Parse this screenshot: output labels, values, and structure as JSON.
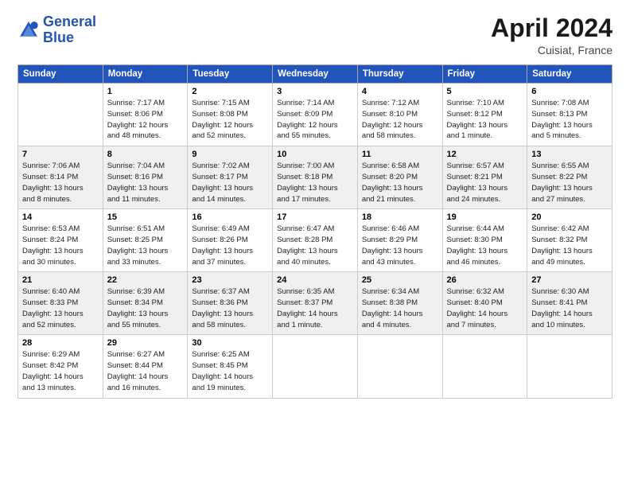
{
  "header": {
    "logo_line1": "General",
    "logo_line2": "Blue",
    "title": "April 2024",
    "location": "Cuisiat, France"
  },
  "days_of_week": [
    "Sunday",
    "Monday",
    "Tuesday",
    "Wednesday",
    "Thursday",
    "Friday",
    "Saturday"
  ],
  "weeks": [
    [
      {
        "day": "",
        "content": ""
      },
      {
        "day": "1",
        "content": "Sunrise: 7:17 AM\nSunset: 8:06 PM\nDaylight: 12 hours\nand 48 minutes."
      },
      {
        "day": "2",
        "content": "Sunrise: 7:15 AM\nSunset: 8:08 PM\nDaylight: 12 hours\nand 52 minutes."
      },
      {
        "day": "3",
        "content": "Sunrise: 7:14 AM\nSunset: 8:09 PM\nDaylight: 12 hours\nand 55 minutes."
      },
      {
        "day": "4",
        "content": "Sunrise: 7:12 AM\nSunset: 8:10 PM\nDaylight: 12 hours\nand 58 minutes."
      },
      {
        "day": "5",
        "content": "Sunrise: 7:10 AM\nSunset: 8:12 PM\nDaylight: 13 hours\nand 1 minute."
      },
      {
        "day": "6",
        "content": "Sunrise: 7:08 AM\nSunset: 8:13 PM\nDaylight: 13 hours\nand 5 minutes."
      }
    ],
    [
      {
        "day": "7",
        "content": "Sunrise: 7:06 AM\nSunset: 8:14 PM\nDaylight: 13 hours\nand 8 minutes."
      },
      {
        "day": "8",
        "content": "Sunrise: 7:04 AM\nSunset: 8:16 PM\nDaylight: 13 hours\nand 11 minutes."
      },
      {
        "day": "9",
        "content": "Sunrise: 7:02 AM\nSunset: 8:17 PM\nDaylight: 13 hours\nand 14 minutes."
      },
      {
        "day": "10",
        "content": "Sunrise: 7:00 AM\nSunset: 8:18 PM\nDaylight: 13 hours\nand 17 minutes."
      },
      {
        "day": "11",
        "content": "Sunrise: 6:58 AM\nSunset: 8:20 PM\nDaylight: 13 hours\nand 21 minutes."
      },
      {
        "day": "12",
        "content": "Sunrise: 6:57 AM\nSunset: 8:21 PM\nDaylight: 13 hours\nand 24 minutes."
      },
      {
        "day": "13",
        "content": "Sunrise: 6:55 AM\nSunset: 8:22 PM\nDaylight: 13 hours\nand 27 minutes."
      }
    ],
    [
      {
        "day": "14",
        "content": "Sunrise: 6:53 AM\nSunset: 8:24 PM\nDaylight: 13 hours\nand 30 minutes."
      },
      {
        "day": "15",
        "content": "Sunrise: 6:51 AM\nSunset: 8:25 PM\nDaylight: 13 hours\nand 33 minutes."
      },
      {
        "day": "16",
        "content": "Sunrise: 6:49 AM\nSunset: 8:26 PM\nDaylight: 13 hours\nand 37 minutes."
      },
      {
        "day": "17",
        "content": "Sunrise: 6:47 AM\nSunset: 8:28 PM\nDaylight: 13 hours\nand 40 minutes."
      },
      {
        "day": "18",
        "content": "Sunrise: 6:46 AM\nSunset: 8:29 PM\nDaylight: 13 hours\nand 43 minutes."
      },
      {
        "day": "19",
        "content": "Sunrise: 6:44 AM\nSunset: 8:30 PM\nDaylight: 13 hours\nand 46 minutes."
      },
      {
        "day": "20",
        "content": "Sunrise: 6:42 AM\nSunset: 8:32 PM\nDaylight: 13 hours\nand 49 minutes."
      }
    ],
    [
      {
        "day": "21",
        "content": "Sunrise: 6:40 AM\nSunset: 8:33 PM\nDaylight: 13 hours\nand 52 minutes."
      },
      {
        "day": "22",
        "content": "Sunrise: 6:39 AM\nSunset: 8:34 PM\nDaylight: 13 hours\nand 55 minutes."
      },
      {
        "day": "23",
        "content": "Sunrise: 6:37 AM\nSunset: 8:36 PM\nDaylight: 13 hours\nand 58 minutes."
      },
      {
        "day": "24",
        "content": "Sunrise: 6:35 AM\nSunset: 8:37 PM\nDaylight: 14 hours\nand 1 minute."
      },
      {
        "day": "25",
        "content": "Sunrise: 6:34 AM\nSunset: 8:38 PM\nDaylight: 14 hours\nand 4 minutes."
      },
      {
        "day": "26",
        "content": "Sunrise: 6:32 AM\nSunset: 8:40 PM\nDaylight: 14 hours\nand 7 minutes."
      },
      {
        "day": "27",
        "content": "Sunrise: 6:30 AM\nSunset: 8:41 PM\nDaylight: 14 hours\nand 10 minutes."
      }
    ],
    [
      {
        "day": "28",
        "content": "Sunrise: 6:29 AM\nSunset: 8:42 PM\nDaylight: 14 hours\nand 13 minutes."
      },
      {
        "day": "29",
        "content": "Sunrise: 6:27 AM\nSunset: 8:44 PM\nDaylight: 14 hours\nand 16 minutes."
      },
      {
        "day": "30",
        "content": "Sunrise: 6:25 AM\nSunset: 8:45 PM\nDaylight: 14 hours\nand 19 minutes."
      },
      {
        "day": "",
        "content": ""
      },
      {
        "day": "",
        "content": ""
      },
      {
        "day": "",
        "content": ""
      },
      {
        "day": "",
        "content": ""
      }
    ]
  ]
}
